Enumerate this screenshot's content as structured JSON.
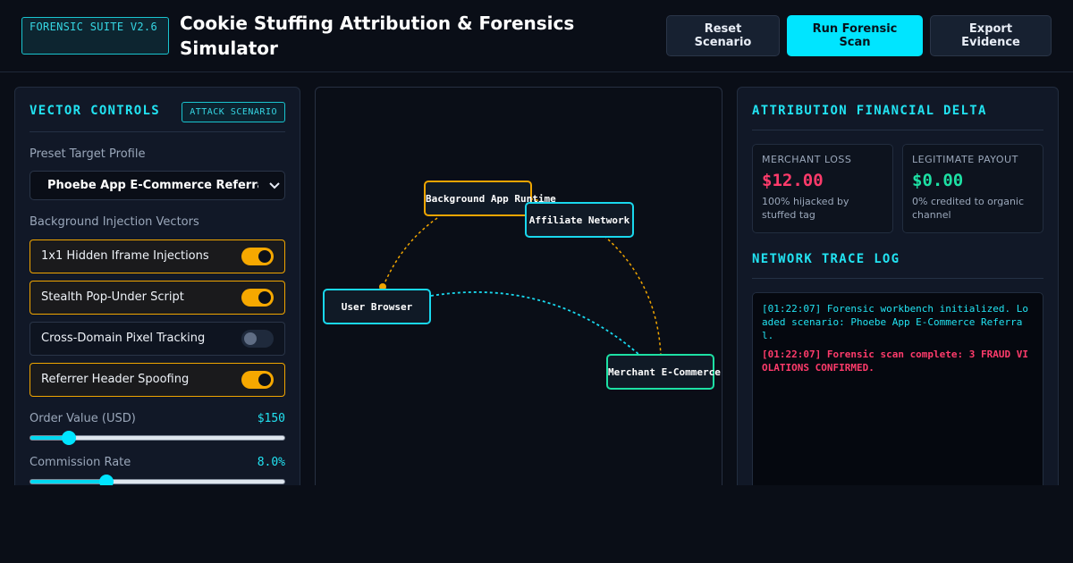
{
  "header": {
    "badge": "FORENSIC SUITE V2.6",
    "title": "Cookie Stuffing Attribution & Forensics Simulator",
    "buttons": {
      "reset": "Reset Scenario",
      "run": "Run Forensic Scan",
      "export": "Export Evidence"
    }
  },
  "controls": {
    "title": "VECTOR CONTROLS",
    "tag": "ATTACK SCENARIO",
    "preset_label": "Preset Target Profile",
    "preset_value": "Phoebe App E-Commerce Referral (D",
    "vectors_label": "Background Injection Vectors",
    "vectors": [
      {
        "label": "1x1 Hidden Iframe Injections",
        "enabled": true
      },
      {
        "label": "Stealth Pop-Under Script",
        "enabled": true
      },
      {
        "label": "Cross-Domain Pixel Tracking",
        "enabled": false
      },
      {
        "label": "Referrer Header Spoofing",
        "enabled": true
      }
    ],
    "order_value": {
      "label": "Order Value (USD)",
      "display": "$150",
      "fraction": 0.15
    },
    "commission": {
      "label": "Commission Rate",
      "display": "8.0%",
      "fraction": 0.3
    }
  },
  "graph": {
    "nodes": {
      "app": "Background App Runtime",
      "affiliate": "Affiliate Network",
      "browser": "User Browser",
      "merchant": "Merchant E-Commerce Sto"
    },
    "colors": {
      "orange": "#f0a500",
      "cyan": "#19d8ee",
      "green": "#1de0a4"
    }
  },
  "financial": {
    "title": "ATTRIBUTION FINANCIAL DELTA",
    "merchant_loss": {
      "caption": "MERCHANT LOSS",
      "amount": "$12.00",
      "note": "100% hijacked by stuffed tag",
      "color": "#ff3b6b"
    },
    "legit_payout": {
      "caption": "LEGITIMATE PAYOUT",
      "amount": "$0.00",
      "note": "0% credited to organic channel",
      "color": "#1de0a4"
    }
  },
  "trace": {
    "title": "NETWORK TRACE LOG",
    "lines": [
      "[01:22:07] Forensic workbench initialized. Loaded scenario: Phoebe App E-Commerce Referral.",
      "[01:22:07] Forensic scan complete: 3 FRAUD VIOLATIONS CONFIRMED."
    ]
  }
}
